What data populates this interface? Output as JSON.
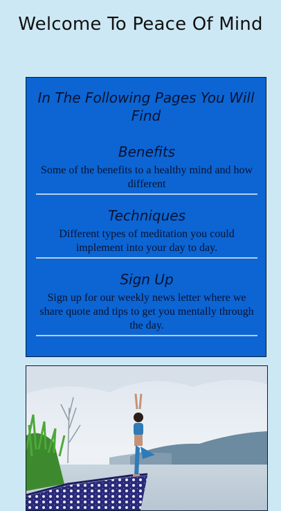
{
  "header": {
    "title": "Welcome To Peace Of Mind"
  },
  "info_card": {
    "heading": "In The Following Pages You Will Find",
    "sections": [
      {
        "title": "Benefits",
        "text": "Some of the benefits to a healthy mind and how different"
      },
      {
        "title": "Techniques",
        "text": "Different types of meditation you could implement into your day to day."
      },
      {
        "title": "Sign Up",
        "text": "Sign up for our weekly news letter where we share quote and tips to get you mentally through the day."
      }
    ]
  },
  "colors": {
    "page_background": "#cce8f4",
    "card_background": "#0c65d3",
    "card_text": "#0a1230",
    "divider": "#b9cde6"
  }
}
